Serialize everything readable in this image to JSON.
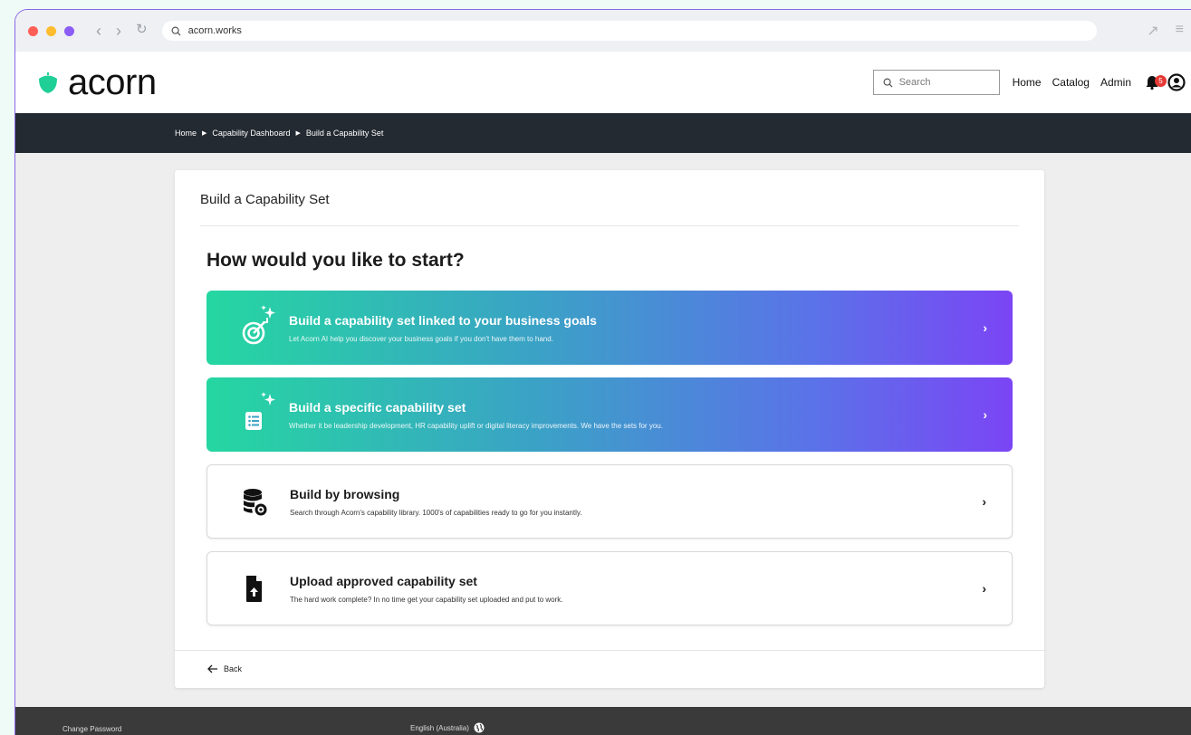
{
  "browser": {
    "url": "acorn.works",
    "dot_colors": [
      "#ff5f57",
      "#febc2e",
      "#8b5cf6"
    ]
  },
  "header": {
    "logo_text": "acorn",
    "brand_color": "#1fcf96",
    "search_placeholder": "Search",
    "links": [
      "Home",
      "Catalog",
      "Admin"
    ],
    "notification_count": "5"
  },
  "breadcrumb": [
    "Home",
    "Capability Dashboard",
    "Build a Capability Set"
  ],
  "card": {
    "title": "Build a Capability Set",
    "question": "How would you like to start?",
    "options": [
      {
        "title": "Build a capability set linked to your business goals",
        "description": "Let Acorn AI help you discover your business goals if you don't have them to hand.",
        "icon": "target-sparkle-icon"
      },
      {
        "title": "Build a specific capability set",
        "description": "Whether it be leadership development, HR capability uplift or digital literacy improvements. We have the sets for you.",
        "icon": "list-sparkle-icon"
      },
      {
        "title": "Build by browsing",
        "description": "Search through Acorn's capability library. 1000's of capabilities ready to go for you instantly.",
        "icon": "database-eye-icon"
      },
      {
        "title": "Upload approved capability set",
        "description": "The hard work complete? In no time get your capability set uploaded and put to work.",
        "icon": "file-upload-icon"
      }
    ],
    "back_label": "Back"
  },
  "footer": {
    "change_password": "Change Password",
    "language": "English (Australia)"
  }
}
